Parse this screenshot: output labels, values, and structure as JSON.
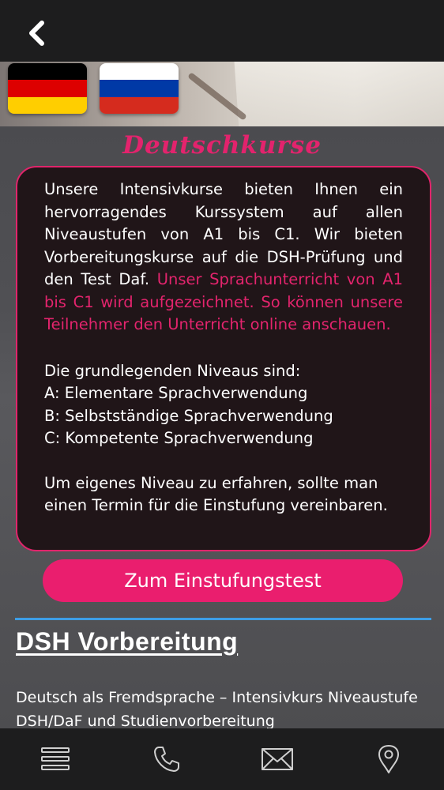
{
  "header": {
    "back_icon": "chevron-left-icon"
  },
  "flags": [
    {
      "country": "Germany",
      "colors": [
        "#000000",
        "#dd0000",
        "#ffce00"
      ]
    },
    {
      "country": "Russia",
      "colors": [
        "#ffffff",
        "#0039a6",
        "#d52b1e"
      ]
    }
  ],
  "main": {
    "title": "Deutschkurse",
    "intro": "Unsere Intensivkurse bieten Ihnen ein hervorragendes Kurssystem auf allen Niveaustufen von A1 bis C1. Wir bieten Vorbereitungskurse auf die DSH-Prüfung und den Test Daf.",
    "highlight": "Unser Sprachunterricht von A1 bis C1 wird aufgezeichnet. So können unsere Teilnehmer den Unterricht online anschauen.",
    "levels_heading": "Die grundlegenden Niveaus sind:",
    "levels": [
      "A: Elementare Sprachverwendung",
      "B: Selbstständige Sprachverwendung",
      "C: Kompetente Sprachverwendung"
    ],
    "closing": "Um eigenes Niveau zu erfahren, sollte man einen Termin für die Einstufung vereinbaren.",
    "cta_label": "Zum Einstufungstest"
  },
  "dsh": {
    "heading": "DSH Vorbereitung",
    "text": "Deutsch als Fremdsprache – Intensivkurs Niveaustufe DSH/DaF und Studienvorbereitung"
  },
  "bottom_nav": [
    {
      "icon": "menu-icon"
    },
    {
      "icon": "phone-icon"
    },
    {
      "icon": "mail-icon"
    },
    {
      "icon": "location-pin-icon"
    }
  ],
  "colors": {
    "accent_pink": "#e3236d",
    "cta_pink": "#ea1e6e",
    "divider_blue": "#3d9ee6",
    "bar_dark": "#1d1d1e",
    "card_bg": "#201518"
  }
}
